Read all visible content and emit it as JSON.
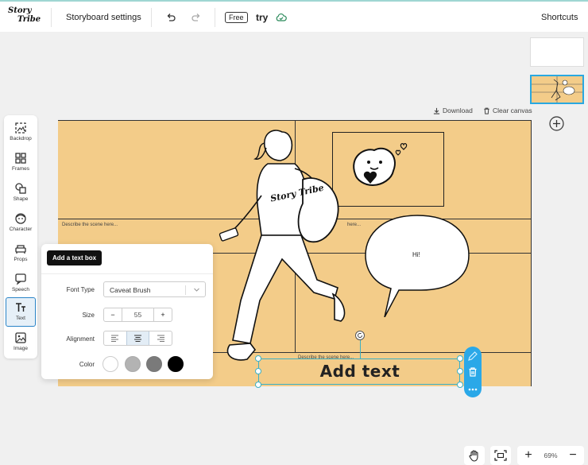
{
  "topbar": {
    "logo": "Story Tribe",
    "storyboard_settings": "Storyboard settings",
    "plan_badge": "Free",
    "project_name": "try",
    "shortcuts": "Shortcuts",
    "undo_icon": "undo-icon",
    "redo_icon": "redo-icon",
    "cloud_icon": "cloud-check-icon"
  },
  "toolbar": {
    "items": [
      {
        "label": "Backdrop",
        "icon": "backdrop-icon"
      },
      {
        "label": "Frames",
        "icon": "frames-icon"
      },
      {
        "label": "Shape",
        "icon": "shape-icon"
      },
      {
        "label": "Character",
        "icon": "character-icon"
      },
      {
        "label": "Props",
        "icon": "props-icon"
      },
      {
        "label": "Speech",
        "icon": "speech-icon"
      },
      {
        "label": "Text",
        "icon": "text-icon",
        "active": true
      },
      {
        "label": "Image",
        "icon": "image-icon"
      }
    ]
  },
  "canvas_actions": {
    "download": "Download",
    "clear_canvas": "Clear canvas"
  },
  "canvas": {
    "descriptions": [
      "Describe the scene here...",
      "here...",
      "Describe the scene here..."
    ],
    "speech_text": "Hi!",
    "shirt_logo": "Story Tribe",
    "text_box_value": "Add text"
  },
  "text_panel": {
    "add_button": "Add a text box",
    "font_type_label": "Font Type",
    "font_type_value": "Caveat Brush",
    "size_label": "Size",
    "size_value": "55",
    "size_minus": "−",
    "size_plus": "+",
    "alignment_label": "Alignment",
    "alignment_selected": "center",
    "color_label": "Color",
    "colors": [
      "#ffffff",
      "#b3b3b3",
      "#7a7a7a",
      "#000000"
    ]
  },
  "zoom": {
    "level": "69%",
    "plus": "+",
    "minus": "−"
  },
  "colors": {
    "canvas_bg": "#f3cc89",
    "accent": "#2aa8e8"
  }
}
